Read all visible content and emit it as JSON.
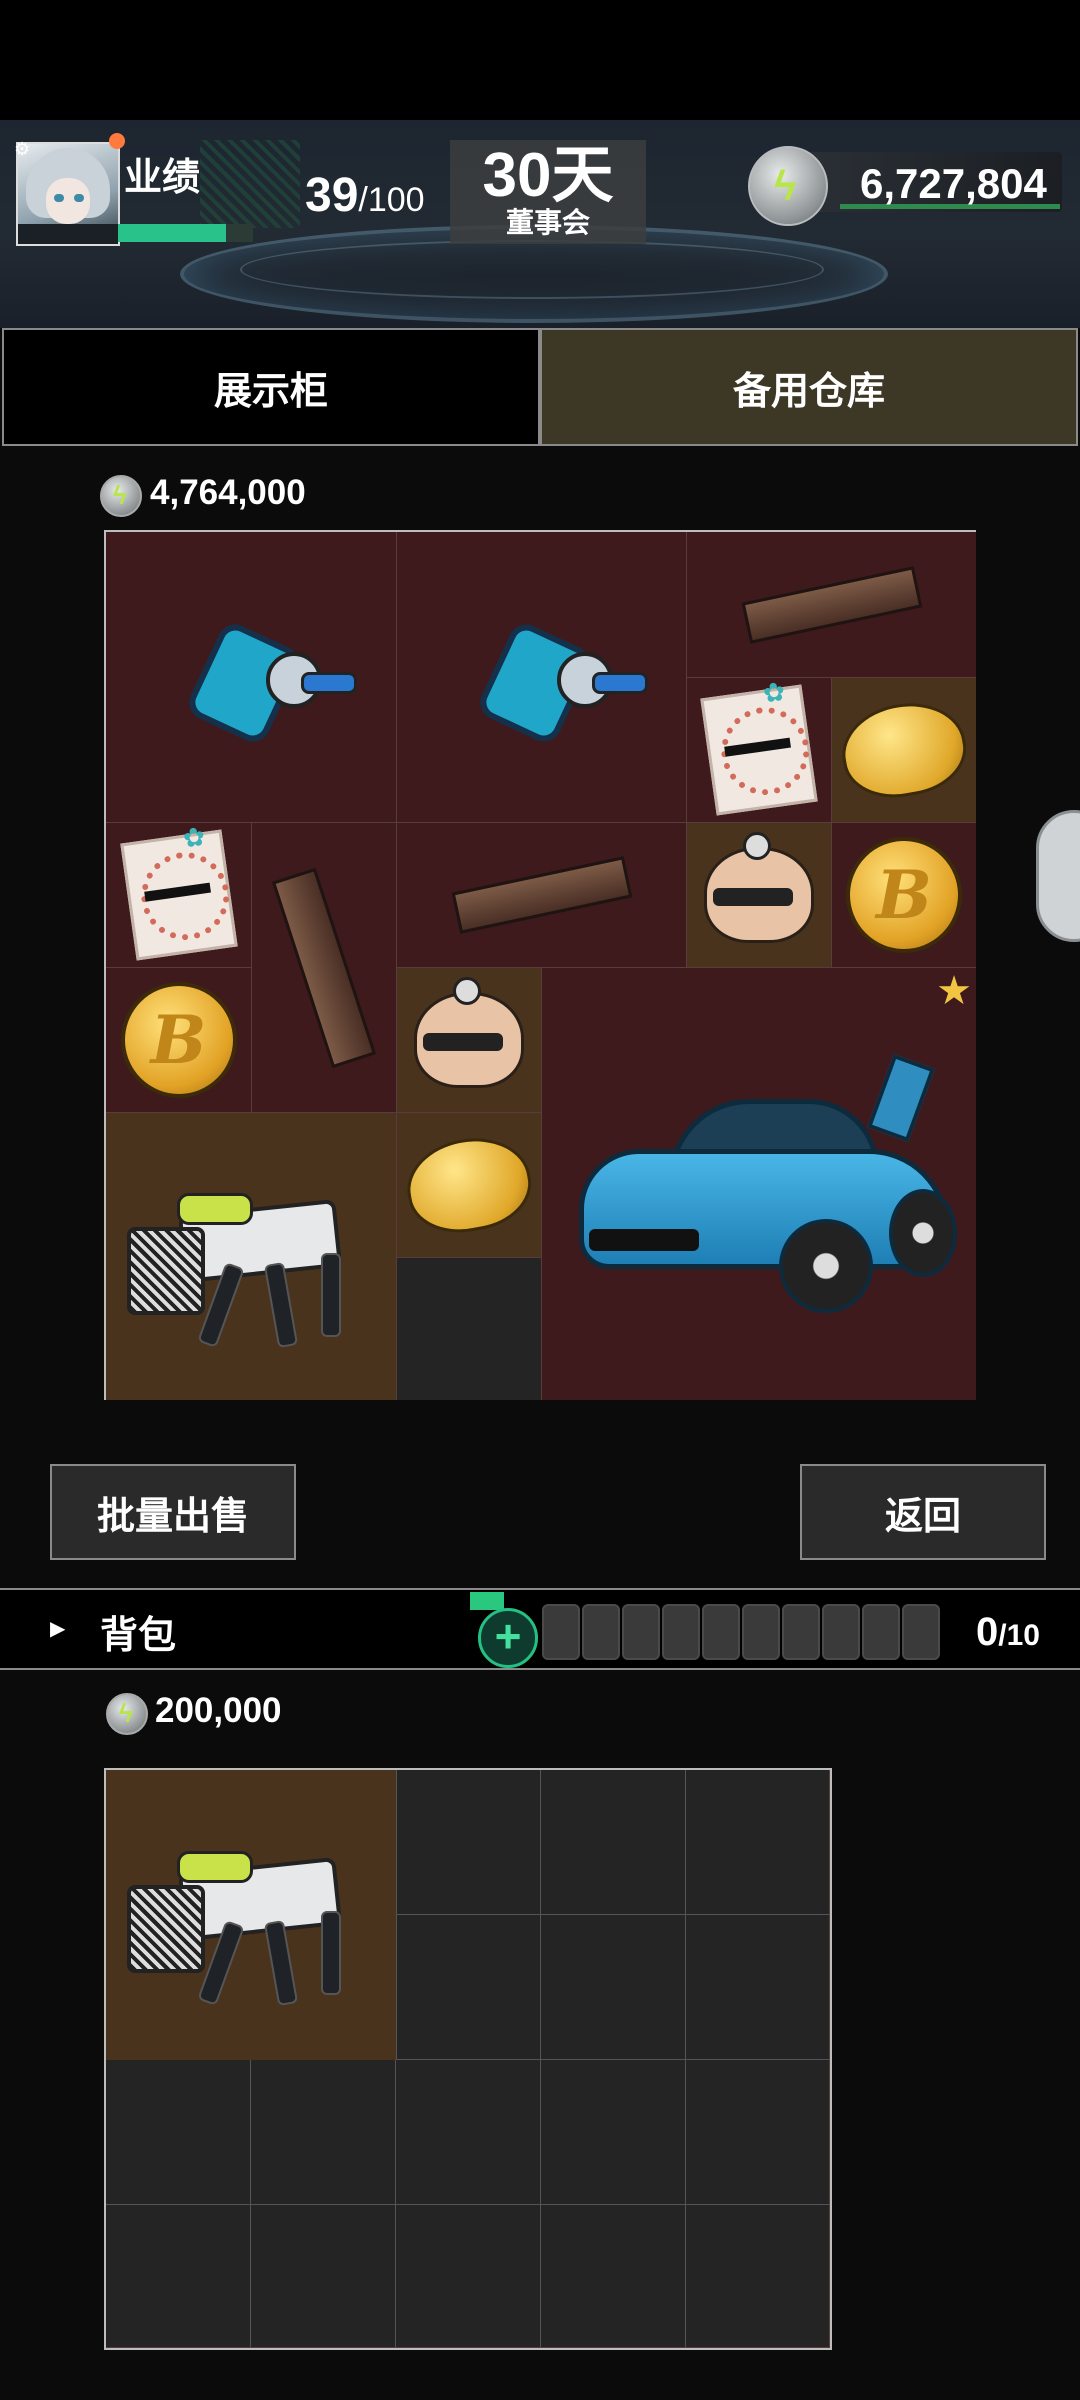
{
  "header": {
    "performance_label": "业绩",
    "performance_value": "39",
    "performance_max": "/100",
    "performance_fraction": 0.39,
    "days_main": "30天",
    "days_sub": "董事会",
    "coin_total": "6,727,804"
  },
  "tabs": [
    {
      "label": "展示柜",
      "active": false
    },
    {
      "label": "备用仓库",
      "active": true
    }
  ],
  "storage": {
    "value": "4,764,000",
    "items": [
      {
        "name": "robot-drone"
      },
      {
        "name": "robot-drone"
      },
      {
        "name": "chocolate-bar"
      },
      {
        "name": "greeting-card"
      },
      {
        "name": "golden-bun"
      },
      {
        "name": "greeting-card"
      },
      {
        "name": "chocolate-bar"
      },
      {
        "name": "chocolate-bar"
      },
      {
        "name": "toy-head"
      },
      {
        "name": "bitcoin"
      },
      {
        "name": "bitcoin"
      },
      {
        "name": "toy-head"
      },
      {
        "name": "robot-dog"
      },
      {
        "name": "golden-bun"
      },
      {
        "name": "sports-car"
      }
    ]
  },
  "buttons": {
    "sell_all": "批量出售",
    "return": "返回"
  },
  "backpack": {
    "title": "背包",
    "slots_used": "0",
    "slots_max": "/10",
    "value": "200,000",
    "items": [
      {
        "name": "robot-dog"
      }
    ]
  },
  "icons": [
    "gear-icon",
    "coin-bolt-icon",
    "star-icon",
    "play-arrow-icon",
    "plus-icon"
  ],
  "colors": {
    "accent_green": "#29c28a",
    "cell_red": "#3e1a1d",
    "cell_brown": "#4a331d",
    "tab_active": "#3d3726",
    "star": "#f1c542"
  }
}
